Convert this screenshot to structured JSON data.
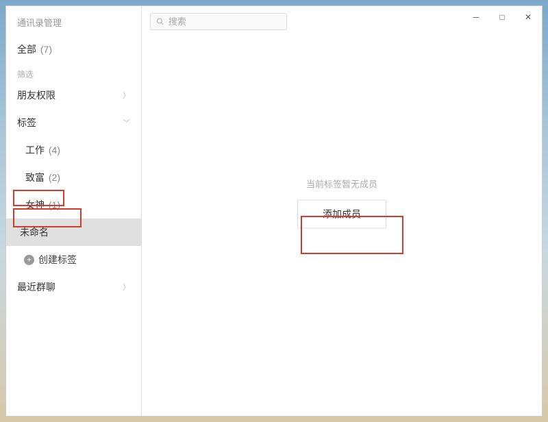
{
  "window": {
    "title": "通讯录管理"
  },
  "sidebar": {
    "all_label": "全部",
    "all_count": "(7)",
    "filter_label": "筛选",
    "friend_perm_label": "朋友权限",
    "tags_label": "标签",
    "tags": [
      {
        "label": "工作",
        "count": "(4)"
      },
      {
        "label": "致富",
        "count": "(2)"
      },
      {
        "label": "女神",
        "count": "(1)"
      },
      {
        "label": "未命名",
        "count": ""
      }
    ],
    "create_tag_label": "创建标签",
    "recent_group_label": "最近群聊"
  },
  "search": {
    "placeholder": "搜索"
  },
  "main": {
    "empty_text": "当前标签暂无成员",
    "add_member_label": "添加成员"
  },
  "window_controls": {
    "minimize": "－",
    "maximize": "□",
    "close": "✕"
  }
}
